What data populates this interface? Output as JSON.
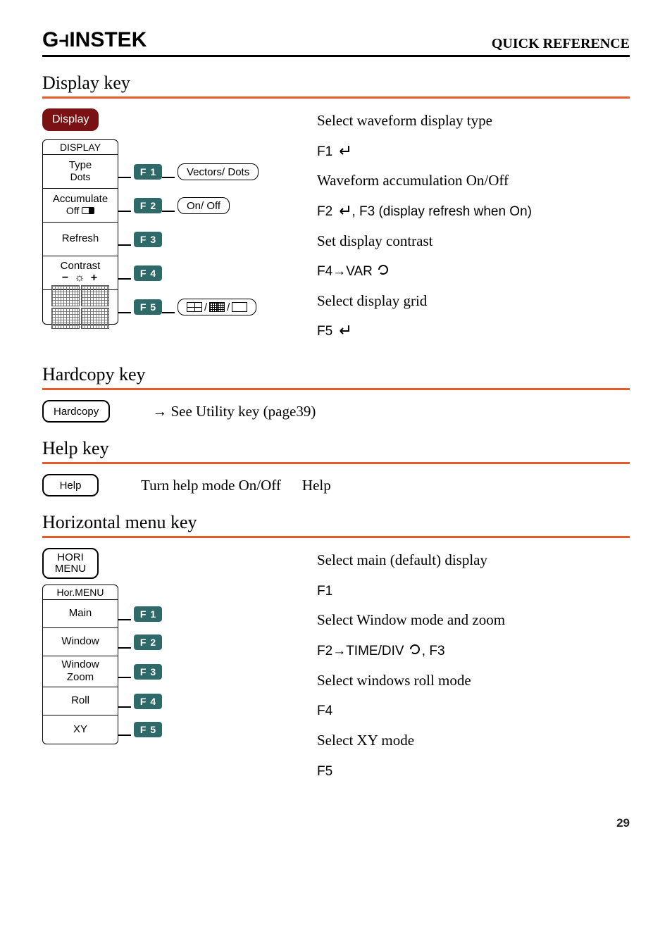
{
  "header": {
    "brand": "GWINSTEK",
    "quick_ref": "QUICK REFERENCE"
  },
  "sections": {
    "display": {
      "title": "Display key",
      "main_button": "Display",
      "menu_head": "DISPLAY",
      "rows": [
        {
          "line1": "Type",
          "line2": "Dots",
          "f": "1",
          "opt": "Vectors/ Dots"
        },
        {
          "line1": "Accumulate",
          "line2_pre": "Off ",
          "f": "2",
          "opt": "On/ Off"
        },
        {
          "line1": "Refresh",
          "f": "3"
        },
        {
          "line1": "Contrast",
          "contrast_row": "− ☼ +",
          "f": "4"
        },
        {
          "grid_cells": true,
          "f": "5",
          "opt_icons": true
        }
      ],
      "right": [
        {
          "text": "Select waveform display type"
        },
        {
          "fkey": "F1",
          "enter": true
        },
        {
          "text": "Waveform accumulation On/Off"
        },
        {
          "fkey": "F2",
          "enter": true,
          "tail": ", F3 (display refresh when On)"
        },
        {
          "text": "Set display contrast"
        },
        {
          "fkey": "F4",
          "arrow": true,
          "word": "VAR",
          "knob": true
        },
        {
          "text": "Select display grid"
        },
        {
          "fkey": "F5",
          "enter": true
        }
      ]
    },
    "hardcopy": {
      "title": "Hardcopy key",
      "button": "Hardcopy",
      "text_arrow": "→",
      "text": " See Utility key (page39)"
    },
    "help": {
      "title": "Help key",
      "button": "Help",
      "text": "Turn help mode On/Off",
      "right": "Help"
    },
    "horizontal": {
      "title": "Horizontal menu key",
      "main_button_l1": "HORI",
      "main_button_l2": "MENU",
      "menu_head": "Hor.MENU",
      "rows": [
        {
          "line1": "Main",
          "f": "1"
        },
        {
          "line1": "Window",
          "f": "2"
        },
        {
          "line1": "Window",
          "line2": "Zoom",
          "f": "3"
        },
        {
          "line1": "Roll",
          "f": "4"
        },
        {
          "line1": "XY",
          "f": "5"
        }
      ],
      "right": [
        {
          "text": "Select main (default) display"
        },
        {
          "fkey": "F1"
        },
        {
          "text": "Select Window mode and zoom"
        },
        {
          "fkey": "F2",
          "arrow": true,
          "word": "TIME/DIV",
          "knob": true,
          "tail": ", F3"
        },
        {
          "text": "Select windows roll mode"
        },
        {
          "fkey": "F4"
        },
        {
          "text": "Select XY mode"
        },
        {
          "fkey": "F5"
        }
      ]
    }
  },
  "page_number": "29",
  "f_labels": {
    "F": "F"
  },
  "icons": {
    "slash": "/"
  }
}
